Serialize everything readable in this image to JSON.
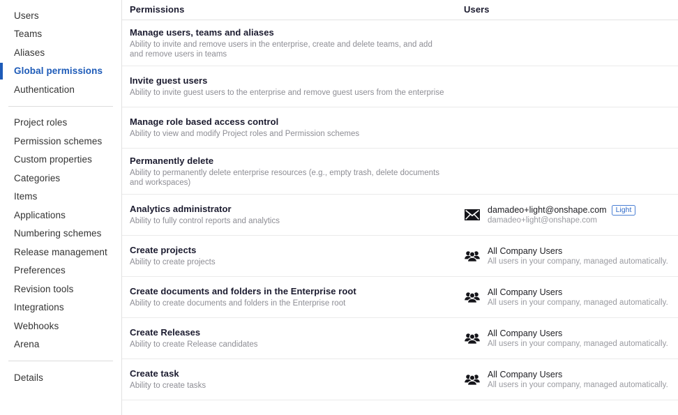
{
  "sidebar": {
    "groups": [
      {
        "items": [
          {
            "label": "Users",
            "active": false,
            "name": "sidebar-item-users"
          },
          {
            "label": "Teams",
            "active": false,
            "name": "sidebar-item-teams"
          },
          {
            "label": "Aliases",
            "active": false,
            "name": "sidebar-item-aliases"
          },
          {
            "label": "Global permissions",
            "active": true,
            "name": "sidebar-item-global-permissions"
          },
          {
            "label": "Authentication",
            "active": false,
            "name": "sidebar-item-authentication"
          }
        ]
      },
      {
        "items": [
          {
            "label": "Project roles",
            "active": false,
            "name": "sidebar-item-project-roles"
          },
          {
            "label": "Permission schemes",
            "active": false,
            "name": "sidebar-item-permission-schemes"
          },
          {
            "label": "Custom properties",
            "active": false,
            "name": "sidebar-item-custom-properties"
          },
          {
            "label": "Categories",
            "active": false,
            "name": "sidebar-item-categories"
          },
          {
            "label": "Items",
            "active": false,
            "name": "sidebar-item-items"
          },
          {
            "label": "Applications",
            "active": false,
            "name": "sidebar-item-applications"
          },
          {
            "label": "Numbering schemes",
            "active": false,
            "name": "sidebar-item-numbering-schemes"
          },
          {
            "label": "Release management",
            "active": false,
            "name": "sidebar-item-release-management"
          },
          {
            "label": "Preferences",
            "active": false,
            "name": "sidebar-item-preferences"
          },
          {
            "label": "Revision tools",
            "active": false,
            "name": "sidebar-item-revision-tools"
          },
          {
            "label": "Integrations",
            "active": false,
            "name": "sidebar-item-integrations"
          },
          {
            "label": "Webhooks",
            "active": false,
            "name": "sidebar-item-webhooks"
          },
          {
            "label": "Arena",
            "active": false,
            "name": "sidebar-item-arena"
          }
        ]
      },
      {
        "items": [
          {
            "label": "Details",
            "active": false,
            "name": "sidebar-item-details"
          }
        ]
      }
    ],
    "active_color": "#1e5bb8"
  },
  "table": {
    "columns": {
      "permissions": "Permissions",
      "users": "Users"
    },
    "rows": [
      {
        "title": "Manage users, teams and aliases",
        "description": "Ability to invite and remove users in the enterprise, create and delete teams, and add and remove users in teams",
        "users": []
      },
      {
        "title": "Invite guest users",
        "description": "Ability to invite guest users to the enterprise and remove guest users from the enterprise",
        "users": []
      },
      {
        "title": "Manage role based access control",
        "description": "Ability to view and modify Project roles and Permission schemes",
        "users": []
      },
      {
        "title": "Permanently delete",
        "description": "Ability to permanently delete enterprise resources (e.g., empty trash, delete documents and workspaces)",
        "users": []
      },
      {
        "title": "Analytics administrator",
        "description": "Ability to fully control reports and analytics",
        "users": [
          {
            "icon": "envelope-icon",
            "primary": "damadeo+light@onshape.com",
            "badge": "Light",
            "secondary": "damadeo+light@onshape.com"
          }
        ]
      },
      {
        "title": "Create projects",
        "description": "Ability to create projects",
        "users": [
          {
            "icon": "group-users-icon",
            "primary": "All Company Users",
            "badge": null,
            "secondary": "All users in your company, managed automatically."
          }
        ]
      },
      {
        "title": "Create documents and folders in the Enterprise root",
        "description": "Ability to create documents and folders in the Enterprise root",
        "users": [
          {
            "icon": "group-users-icon",
            "primary": "All Company Users",
            "badge": null,
            "secondary": "All users in your company, managed automatically."
          }
        ]
      },
      {
        "title": "Create Releases",
        "description": "Ability to create Release candidates",
        "users": [
          {
            "icon": "group-users-icon",
            "primary": "All Company Users",
            "badge": null,
            "secondary": "All users in your company, managed automatically."
          }
        ]
      },
      {
        "title": "Create task",
        "description": "Ability to create tasks",
        "users": [
          {
            "icon": "group-users-icon",
            "primary": "All Company Users",
            "badge": null,
            "secondary": "All users in your company, managed automatically."
          }
        ]
      }
    ]
  },
  "colors": {
    "accent": "#1e5bb8",
    "badge_border": "#4a7fd4",
    "badge_text": "#2f6ac8",
    "title_text": "#1b1b2f",
    "desc_text": "#8d8d94"
  }
}
